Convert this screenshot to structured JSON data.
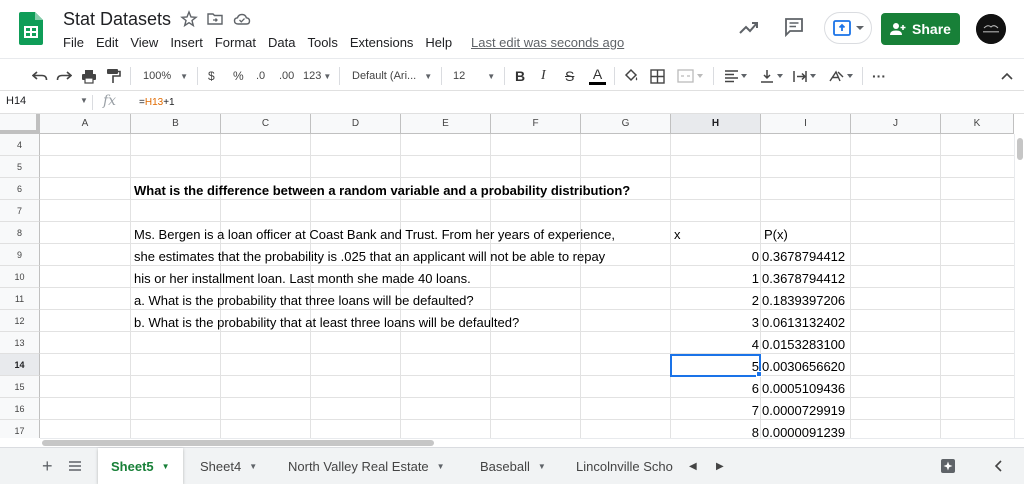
{
  "app": {
    "doc_title": "Stat Datasets",
    "last_edit": "Last edit was seconds ago",
    "share_label": "Share",
    "colors": {
      "green": "#188038",
      "accent": "#1a73e8",
      "logo": "#0f9d58"
    }
  },
  "menu": [
    "File",
    "Edit",
    "View",
    "Insert",
    "Format",
    "Data",
    "Tools",
    "Extensions",
    "Help"
  ],
  "toolbar": {
    "zoom": "100%",
    "currency": "$",
    "percent": "%",
    "decrease_decimals": ".0",
    "increase_decimals": ".00",
    "more_formats": "123",
    "font": "Default (Ari...",
    "font_size": "12",
    "bold": "B",
    "italic": "I",
    "strikethrough": "S",
    "text_color": "A",
    "more": "···"
  },
  "formula_bar": {
    "cell_ref": "H14",
    "fx": "fx",
    "formula_prefix": "=",
    "formula_ref": "H13",
    "formula_suffix": "+1"
  },
  "grid": {
    "columns": [
      "A",
      "B",
      "C",
      "D",
      "E",
      "F",
      "G",
      "H",
      "I",
      "J",
      "K"
    ],
    "rows": [
      "4",
      "5",
      "6",
      "7",
      "8",
      "9",
      "10",
      "11",
      "12",
      "13",
      "14",
      "15",
      "16",
      "17"
    ],
    "active_cell": "H14",
    "question": "What is the difference between a random variable and a probability distribution?",
    "problem_lines": [
      "Ms. Bergen is a loan officer at Coast Bank and Trust. From her years of experience,",
      "she estimates that the probability is .025 that an applicant will not be able to repay",
      "his or her installment loan. Last month she made 40 loans.",
      "a. What is the probability that three loans will be defaulted?",
      "b. What is the probability that at least three loans will be defaulted?"
    ],
    "header_x": "x",
    "header_px": "P(x)",
    "x_values": [
      "0",
      "1",
      "2",
      "3",
      "4",
      "5",
      "6",
      "7",
      "8"
    ],
    "p_values": [
      "0.3678794412",
      "0.3678794412",
      "0.1839397206",
      "0.0613132402",
      "0.0153283100",
      "0.0030656620",
      "0.0005109436",
      "0.0000729919",
      "0.0000091239"
    ]
  },
  "sheets": {
    "tabs": [
      "Sheet5",
      "Sheet4",
      "North Valley Real Estate",
      "Baseball",
      "Lincolnville Scho"
    ],
    "active": "Sheet5"
  }
}
